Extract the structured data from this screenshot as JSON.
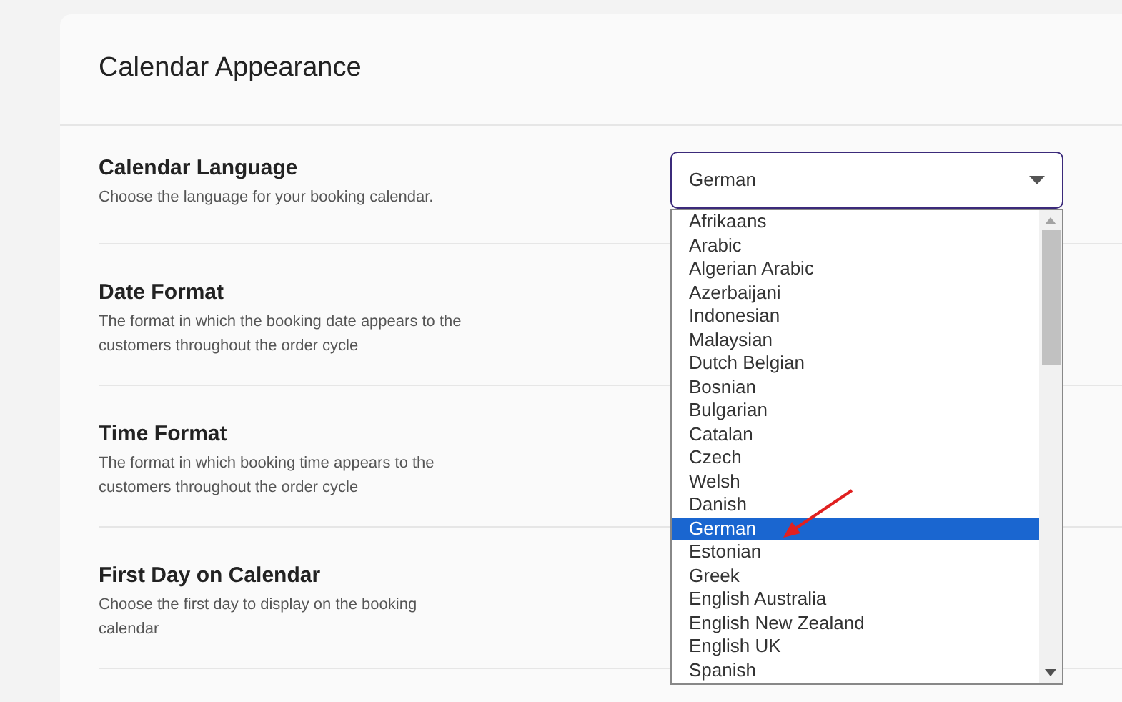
{
  "card": {
    "title": "Calendar Appearance"
  },
  "settings": [
    {
      "title": "Calendar Language",
      "description": "Choose the language for your booking calendar.",
      "select": {
        "value": "German",
        "expanded": true,
        "options": [
          {
            "label": "Afrikaans",
            "selected": false
          },
          {
            "label": "Arabic",
            "selected": false
          },
          {
            "label": "Algerian Arabic",
            "selected": false
          },
          {
            "label": "Azerbaijani",
            "selected": false
          },
          {
            "label": "Indonesian",
            "selected": false
          },
          {
            "label": "Malaysian",
            "selected": false
          },
          {
            "label": "Dutch Belgian",
            "selected": false
          },
          {
            "label": "Bosnian",
            "selected": false
          },
          {
            "label": "Bulgarian",
            "selected": false
          },
          {
            "label": "Catalan",
            "selected": false
          },
          {
            "label": "Czech",
            "selected": false
          },
          {
            "label": "Welsh",
            "selected": false
          },
          {
            "label": "Danish",
            "selected": false
          },
          {
            "label": "German",
            "selected": true
          },
          {
            "label": "Estonian",
            "selected": false
          },
          {
            "label": "Greek",
            "selected": false
          },
          {
            "label": "English Australia",
            "selected": false
          },
          {
            "label": "English New Zealand",
            "selected": false
          },
          {
            "label": "English UK",
            "selected": false
          },
          {
            "label": "Spanish",
            "selected": false
          }
        ]
      }
    },
    {
      "title": "Date Format",
      "description": "The format in which the booking date appears to the customers throughout the order cycle"
    },
    {
      "title": "Time Format",
      "description": "The format in which booking time appears to the customers throughout the order cycle"
    },
    {
      "title": "First Day on Calendar",
      "description": "Choose the first day to display on the booking calendar"
    }
  ]
}
